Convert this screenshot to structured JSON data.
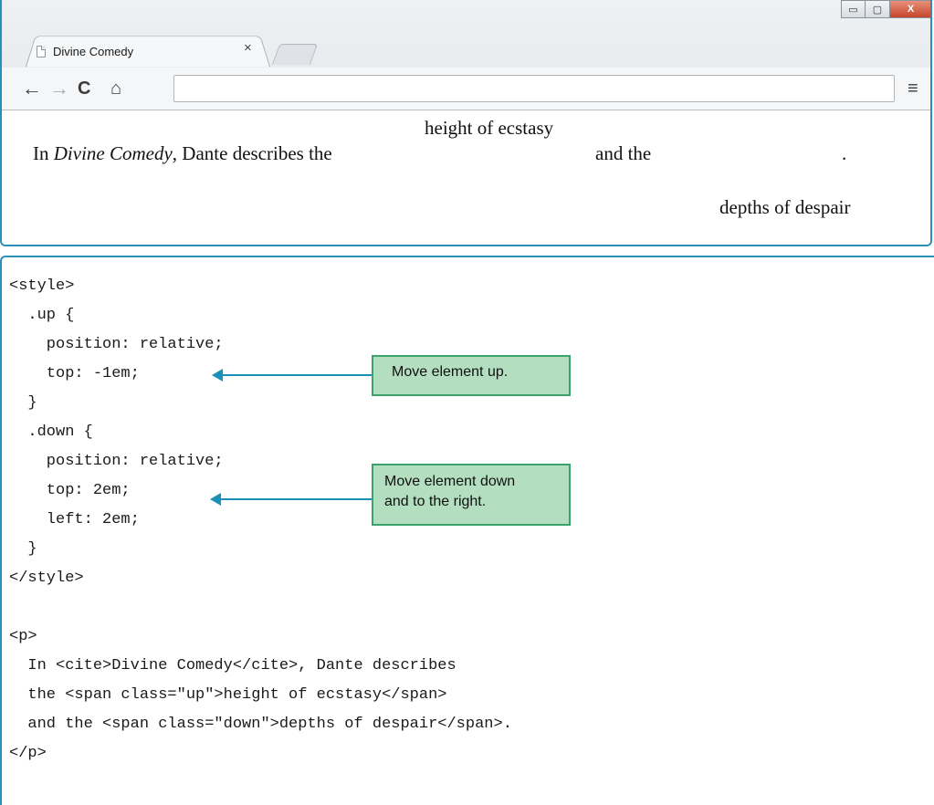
{
  "browser": {
    "tab_title": "Divine Comedy",
    "tab_close": "×",
    "address_value": "",
    "icons": {
      "back": "←",
      "forward": "→",
      "reload": "C",
      "home": "⌂",
      "menu": "≡",
      "minimize": "▭",
      "maximize": "▢",
      "close": "X"
    },
    "viewport": {
      "text_before": "In ",
      "cite": "Divine Comedy",
      "text_after": ", Dante describes the",
      "up_text": "height of ecstasy",
      "and_text": "and the",
      "period": ".",
      "down_text": "depths of despair"
    }
  },
  "code": {
    "lines": [
      "<style>",
      "  .up {",
      "    position: relative;",
      "    top: -1em;",
      "  }",
      "  .down {",
      "    position: relative;",
      "    top: 2em;",
      "    left: 2em;",
      "  }",
      "</style>",
      "",
      "<p>",
      "  In <cite>Divine Comedy</cite>, Dante describes",
      "  the <span class=\"up\">height of ecstasy</span>",
      "  and the <span class=\"down\">depths of despair</span>.",
      "</p>"
    ]
  },
  "callouts": {
    "up": "Move element up.",
    "down_line1": "Move element down",
    "down_line2": "and to the right."
  },
  "colors": {
    "frame_border": "#2a8fb8",
    "callout_fill": "#b3dfc0",
    "callout_border": "#3ba36a",
    "arrow": "#1a8fb8"
  }
}
